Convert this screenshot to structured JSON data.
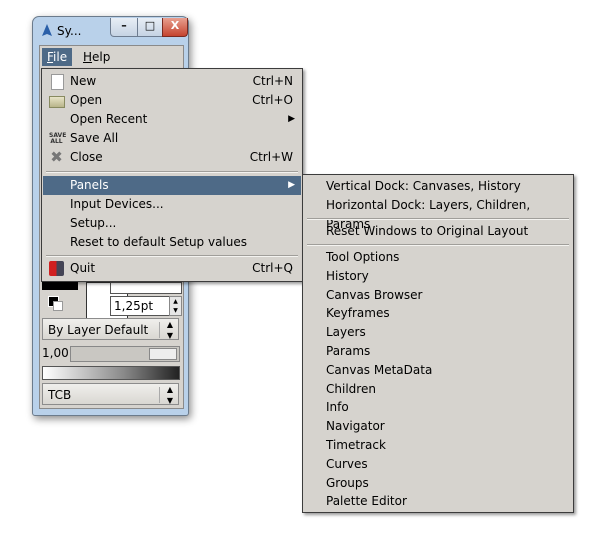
{
  "window": {
    "title": "Sy...",
    "controls": {
      "minimize": "–",
      "maximize": "□",
      "close": "X"
    }
  },
  "menubar": {
    "items": [
      {
        "label": "File",
        "mnemonic": "F",
        "active": true
      },
      {
        "label": "Help",
        "mnemonic": "H",
        "active": false
      }
    ]
  },
  "toolbox": {
    "width_value": "1,25pt",
    "blend_method": "By Layer Default",
    "opacity_value": "1,00",
    "interpolation": "TCB"
  },
  "file_menu": {
    "items": [
      {
        "label": "New",
        "accel": "Ctrl+N",
        "icon": "new-document-icon"
      },
      {
        "label": "Open",
        "accel": "Ctrl+O",
        "icon": "folder-open-icon"
      },
      {
        "label": "Open Recent",
        "accel": "",
        "submenu": true
      },
      {
        "label": "Save All",
        "accel": "",
        "icon": "save-all-icon",
        "icon_text": "SAVE ALL"
      },
      {
        "label": "Close",
        "accel": "Ctrl+W",
        "icon": "close-x-icon"
      },
      {
        "label": "Panels",
        "accel": "",
        "submenu": true,
        "highlighted": true
      },
      {
        "label": "Input Devices...",
        "accel": ""
      },
      {
        "label": "Setup...",
        "accel": ""
      },
      {
        "label": "Reset to default Setup values",
        "accel": ""
      },
      {
        "label": "Quit",
        "accel": "Ctrl+Q",
        "icon": "quit-icon"
      }
    ]
  },
  "panels_menu": {
    "layouts": [
      "Vertical Dock: Canvases, History",
      "Horizontal Dock: Layers, Children, Params"
    ],
    "reset": "Reset Windows to Original Layout",
    "panels": [
      "Tool Options",
      "History",
      "Canvas Browser",
      "Keyframes",
      "Layers",
      "Params",
      "Canvas MetaData",
      "Children",
      "Info",
      "Navigator",
      "Timetrack",
      "Curves",
      "Groups",
      "Palette Editor"
    ]
  },
  "colors": {
    "highlight": "#4e6a87",
    "menu_bg": "#d6d3ce",
    "window_frame": "#b9d1ea"
  }
}
